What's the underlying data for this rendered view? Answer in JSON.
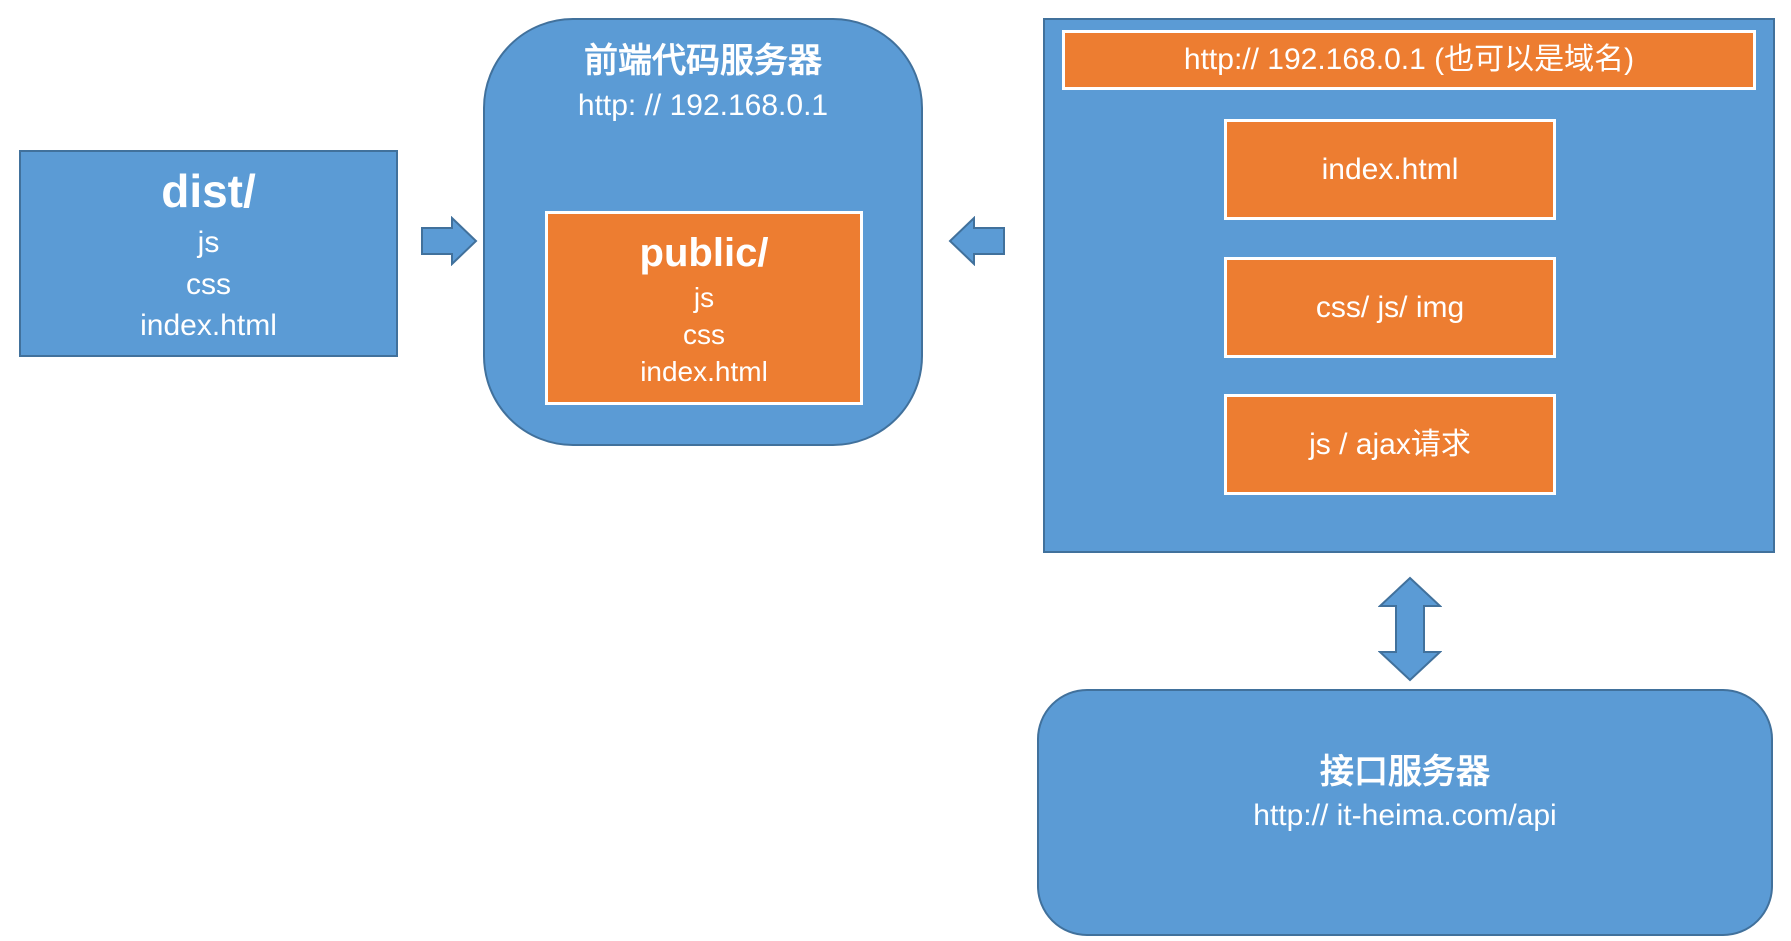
{
  "colors": {
    "box_blue": "#5b9bd5",
    "box_blue_border": "#41719c",
    "box_orange": "#ed7d31",
    "text": "#ffffff"
  },
  "dist_box": {
    "title": "dist/",
    "items": [
      "js",
      "css",
      "index.html"
    ]
  },
  "frontend_server": {
    "title": "前端代码服务器",
    "address": "http: // 192.168.0.1",
    "public_box": {
      "title": "public/",
      "items": [
        "js",
        "css",
        "index.html"
      ]
    }
  },
  "browser_box": {
    "address_bar": "http:// 192.168.0.1 (也可以是域名)",
    "items": [
      "index.html",
      "css/ js/ img",
      "js / ajax请求"
    ]
  },
  "api_server": {
    "title": "接口服务器",
    "address": "http:// it-heima.com/api"
  },
  "arrows": [
    "right-arrow",
    "left-arrow",
    "up-down-arrow"
  ]
}
